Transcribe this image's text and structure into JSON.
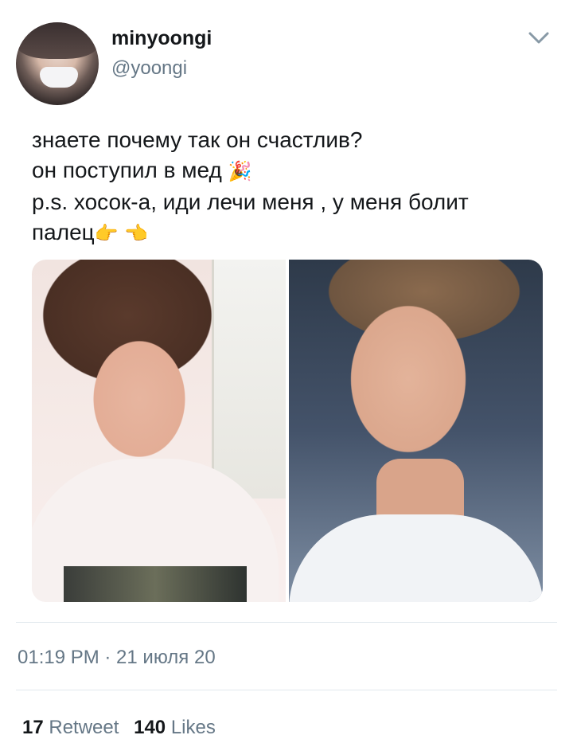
{
  "user": {
    "display_name": "minyoongi",
    "handle": "@yoongi"
  },
  "tweet": {
    "lines": [
      "знаете почему так он счастлив?",
      "он поступил в мед",
      "p.s. хосок-а, иди лечи меня , у меня болит",
      "палец"
    ],
    "emoji_party": "🎉",
    "emoji_point_right": "👉",
    "emoji_point_left": "👈",
    "timestamp": "01:19 PM · 21 июля 20"
  },
  "stats": {
    "retweets_count": "17",
    "retweets_label": "Retweet",
    "likes_count": "140",
    "likes_label": "Likes"
  },
  "icons": {
    "menu": "chevron-down-icon"
  },
  "colors": {
    "text": "#14171a",
    "secondary": "#657786",
    "divider": "#e1e8ed"
  }
}
